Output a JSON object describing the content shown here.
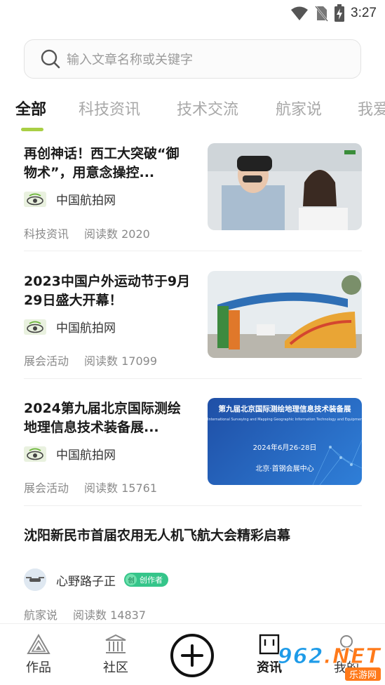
{
  "status_bar": {
    "time": "3:27"
  },
  "search": {
    "placeholder": "输入文章名称或关键字"
  },
  "tabs": [
    {
      "label": "全部",
      "active": true
    },
    {
      "label": "科技资讯",
      "active": false
    },
    {
      "label": "技术交流",
      "active": false
    },
    {
      "label": "航家说",
      "active": false
    },
    {
      "label": "我爱",
      "active": false
    }
  ],
  "articles": [
    {
      "title": "再创神话！西工大突破“御物术”，用意念操控...",
      "source": "中国航拍网",
      "category": "科技资讯",
      "reads": "阅读数 2020",
      "thumb": "vr-headset-lab"
    },
    {
      "title": "2023中国户外运动节于9月29日盛大开幕！",
      "source": "中国航拍网",
      "category": "展会活动",
      "reads": "阅读数 17099",
      "thumb": "outdoor-festival-gate"
    },
    {
      "title": "2024第九届北京国际测绘地理信息技术装备展...",
      "source": "中国航拍网",
      "category": "展会活动",
      "reads": "阅读数 15761",
      "thumb": "expo-banner",
      "thumb_text": {
        "headline": "第九届北京国际测绘地理信息技术装备展",
        "english": "International Surveying and Mapping Geographic Information Technology and Equipment Exhibition",
        "date": "2024年6月26-28日",
        "venue": "北京·首钢会展中心"
      }
    },
    {
      "title": "沈阳新民市首届农用无人机飞航大会精彩启幕",
      "author": "心野路子正",
      "badge": "创作者",
      "badge_icon": "创",
      "category": "航家说",
      "reads": "阅读数 14837"
    }
  ],
  "bottom_nav": {
    "items": [
      {
        "label": "作品",
        "icon": "triangle-works-icon"
      },
      {
        "label": "社区",
        "icon": "building-community-icon"
      },
      {
        "label": "资讯",
        "icon": "news-window-icon",
        "active": true
      },
      {
        "label": "我的",
        "icon": "profile-icon"
      }
    ],
    "center_icon": "add-icon"
  },
  "watermark": {
    "main_digits": "962",
    "main_suffix": ".NET",
    "sub": "乐游网"
  },
  "colors": {
    "accent": "#a9cf45",
    "badge": "#35c58a",
    "watermark": "#ff7a1a"
  }
}
